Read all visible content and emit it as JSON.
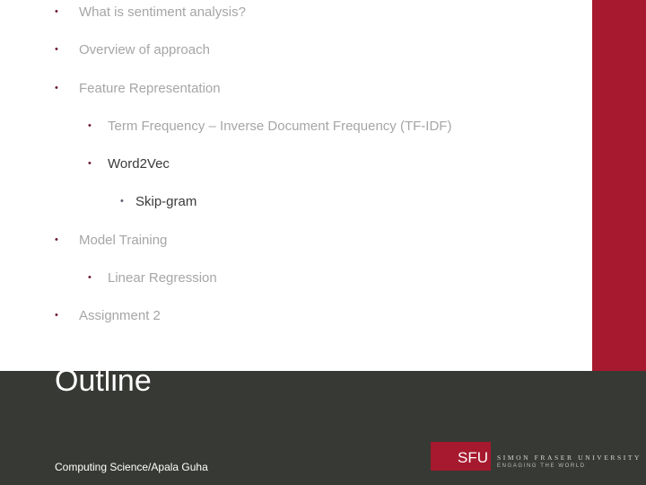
{
  "slide": {
    "title": "Outline",
    "footer": "Computing Science/Apala Guha",
    "colors": {
      "accent_red": "#a6192e",
      "footer_bg": "#373934",
      "inactive_text": "#a6a6a6",
      "active_text": "#3a3a3a"
    },
    "outline": [
      {
        "text": "What is sentiment analysis?",
        "level": 1,
        "active": false
      },
      {
        "text": "Overview of approach",
        "level": 1,
        "active": false
      },
      {
        "text": "Feature Representation",
        "level": 1,
        "active": false
      },
      {
        "text": "Term Frequency – Inverse Document Frequency (TF-IDF)",
        "level": 2,
        "active": false
      },
      {
        "text": "Word2Vec",
        "level": 2,
        "active": true
      },
      {
        "text": "Skip-gram",
        "level": 3,
        "active": true
      },
      {
        "text": "Model Training",
        "level": 1,
        "active": false
      },
      {
        "text": "Linear Regression",
        "level": 2,
        "active": false
      },
      {
        "text": "Assignment 2",
        "level": 1,
        "active": false
      }
    ],
    "bullet": "•",
    "logo": {
      "abbr": "SFU",
      "name": "SIMON FRASER UNIVERSITY",
      "tagline": "ENGAGING THE WORLD"
    }
  }
}
